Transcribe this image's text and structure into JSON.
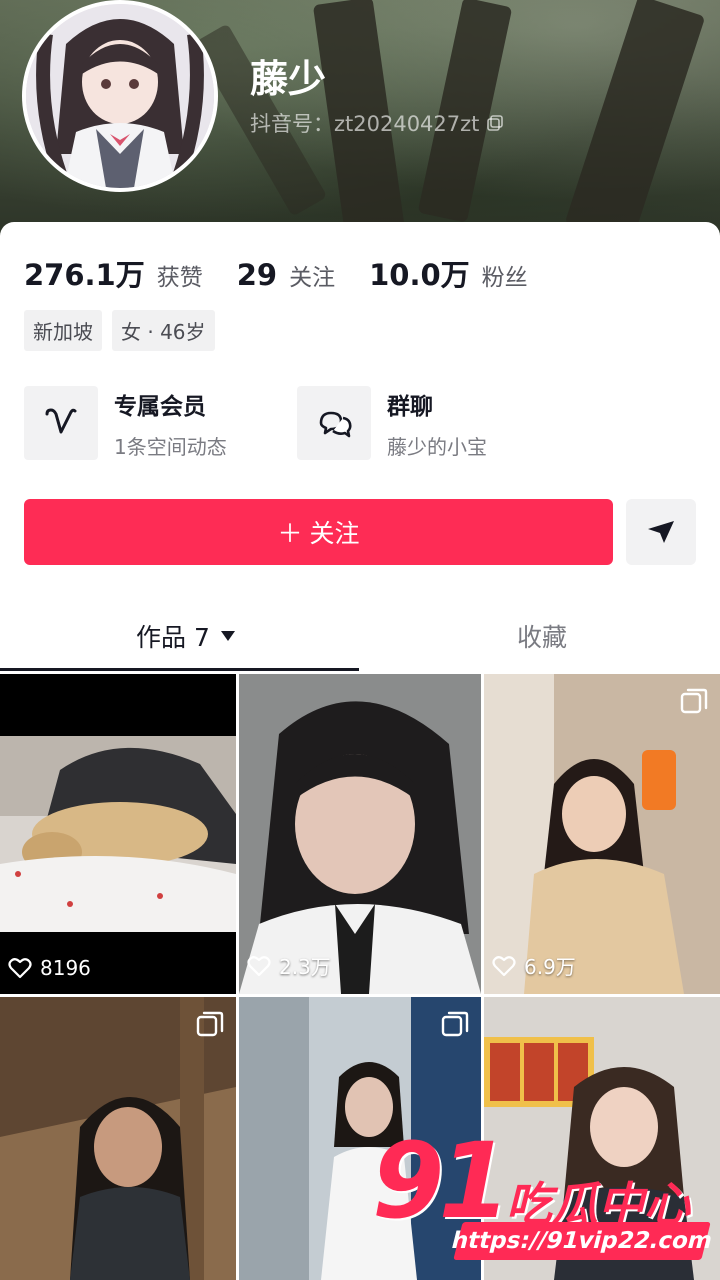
{
  "profile": {
    "name": "藤少",
    "douyin_id": "抖音号：zt20240427zt"
  },
  "stats": [
    {
      "value": "276.1万",
      "label": "获赞"
    },
    {
      "value": "29",
      "label": "关注"
    },
    {
      "value": "10.0万",
      "label": "粉丝"
    }
  ],
  "tags": [
    "新加坡",
    "女 · 46岁"
  ],
  "features": [
    {
      "title": "专属会员",
      "subtitle": "1条空间动态",
      "icon": "heart-v-icon"
    },
    {
      "title": "群聊",
      "subtitle": "藤少的小宝",
      "icon": "chat-bubbles-icon"
    }
  ],
  "actions": {
    "follow_label": "＋ 关注",
    "share_icon": "send-icon"
  },
  "tabs": {
    "works_label": "作品 7",
    "favorites_label": "收藏"
  },
  "grid": [
    {
      "likes": "8196"
    },
    {
      "likes": "2.3万"
    },
    {
      "likes": "6.9万"
    },
    {
      "likes": ""
    },
    {
      "likes": ""
    },
    {
      "likes": ""
    }
  ],
  "watermark": {
    "number": "91",
    "text": "吃瓜中心",
    "url": "https://91vip22.com"
  },
  "colors": {
    "accent": "#fe2c55",
    "text_primary": "#161823",
    "text_secondary": "#7a7b82"
  }
}
